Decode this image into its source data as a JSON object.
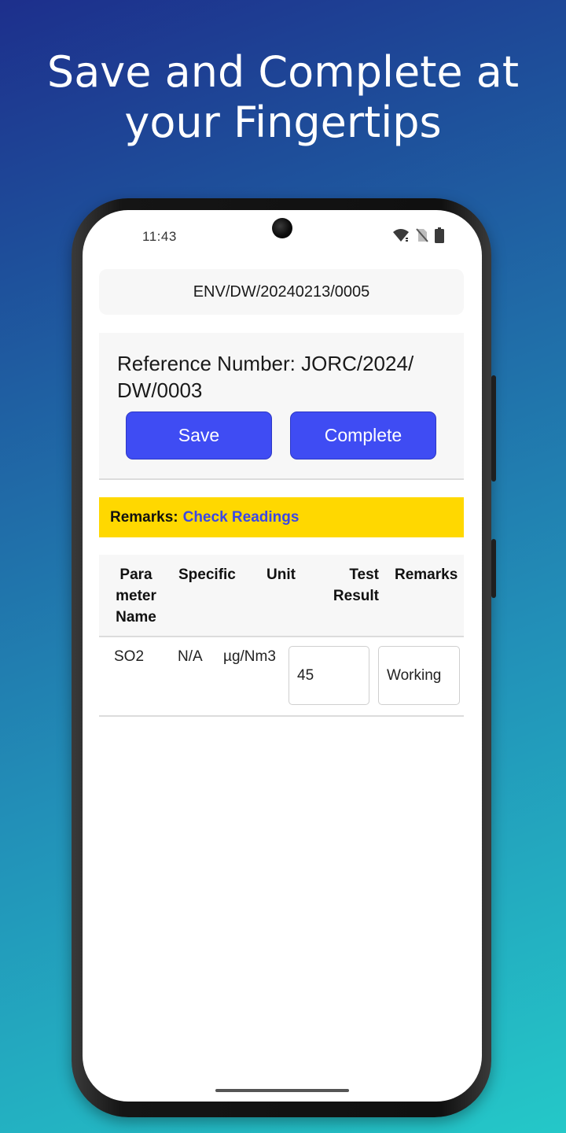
{
  "promo": {
    "headline_line1": "Save and Complete at",
    "headline_line2": "your Fingertips"
  },
  "status_bar": {
    "time": "11:43",
    "icons": [
      "wifi-icon",
      "no-sim-icon",
      "battery-icon"
    ]
  },
  "form": {
    "document_id": "ENV/DW/20240213/0005",
    "reference_line1": "Reference Number: JORC/2024/",
    "reference_line2": "DW/0003",
    "save_label": "Save",
    "complete_label": "Complete"
  },
  "remarks": {
    "label": "Remarks:",
    "value": "Check Readings"
  },
  "table": {
    "headers": [
      {
        "lines": [
          "Para",
          "meter",
          "Name"
        ]
      },
      {
        "lines": [
          "Specific"
        ]
      },
      {
        "lines": [
          "Unit"
        ]
      },
      {
        "lines": [
          "Test",
          "Result"
        ]
      },
      {
        "lines": [
          "Remarks"
        ]
      }
    ],
    "rows": [
      {
        "parameter": "SO2",
        "specific": "N/A",
        "unit": "µg/Nm3",
        "test_result": "45",
        "remarks": "Working"
      }
    ]
  },
  "colors": {
    "primary_button": "#3f4cf3",
    "remarks_background": "#ffd800",
    "remarks_value": "#3a47e6"
  }
}
